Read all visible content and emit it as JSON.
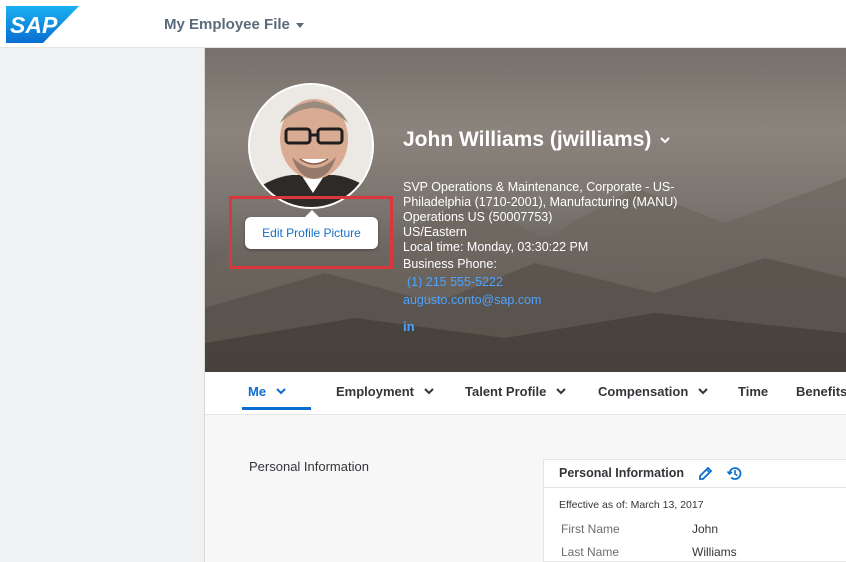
{
  "shell": {
    "logo_text": "SAP",
    "app_title": "My Employee File"
  },
  "profile": {
    "name": "John Williams (jwilliams)",
    "edit_picture_label": "Edit Profile Picture",
    "job_line1": "SVP Operations & Maintenance, Corporate - US-",
    "job_line2": "Philadelphia (1710-2001), Manufacturing (MANU)",
    "job_line3": "Operations US (50007753)",
    "timezone": "US/Eastern",
    "local_time": "Local time: Monday, 03:30:22 PM",
    "phone_label": "Business Phone:",
    "phone": "(1) 215 555-5222",
    "email": "augusto.conto@sap.com",
    "linkedin": "in"
  },
  "tabs": [
    {
      "label": "Me",
      "active": true,
      "has_chevron": true
    },
    {
      "label": "Employment",
      "has_chevron": true
    },
    {
      "label": "Talent Profile",
      "has_chevron": true
    },
    {
      "label": "Compensation",
      "has_chevron": true
    },
    {
      "label": "Time",
      "has_chevron": false
    },
    {
      "label": "Benefits",
      "has_chevron": false
    }
  ],
  "content": {
    "section_title": "Personal Information",
    "card": {
      "title": "Personal Information",
      "effective": "Effective as of: March 13, 2017",
      "rows": [
        {
          "label": "First Name",
          "value": "John"
        },
        {
          "label": "Last Name",
          "value": "Williams"
        }
      ]
    }
  },
  "colors": {
    "accent": "#0a6ed1",
    "link": "#4da3ff",
    "highlight_box": "#d9363e"
  }
}
